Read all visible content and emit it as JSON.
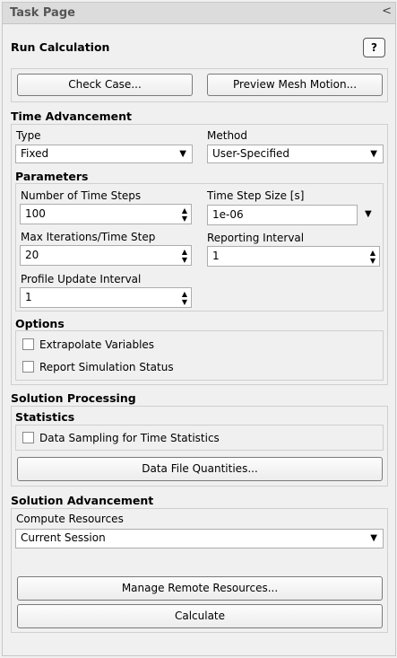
{
  "panel": {
    "title": "Task Page",
    "close": "<"
  },
  "run": {
    "heading": "Run Calculation",
    "help": "?"
  },
  "buttons": {
    "check_case": "Check Case...",
    "preview_mesh": "Preview Mesh Motion..."
  },
  "time_adv": {
    "heading": "Time Advancement",
    "type_label": "Type",
    "type_value": "Fixed",
    "method_label": "Method",
    "method_value": "User-Specified"
  },
  "params": {
    "heading": "Parameters",
    "num_steps_label": "Number of Time Steps",
    "num_steps_value": "100",
    "step_size_label": "Time Step Size [s]",
    "step_size_value": "1e-06",
    "max_iter_label": "Max Iterations/Time Step",
    "max_iter_value": "20",
    "report_label": "Reporting Interval",
    "report_value": "1",
    "profile_label": "Profile Update Interval",
    "profile_value": "1"
  },
  "options": {
    "heading": "Options",
    "extrapolate": "Extrapolate Variables",
    "report_status": "Report Simulation Status"
  },
  "solution_processing": {
    "heading": "Solution Processing",
    "statistics_heading": "Statistics",
    "data_sampling": "Data Sampling for Time Statistics",
    "data_file_btn": "Data File Quantities..."
  },
  "solution_adv": {
    "heading": "Solution Advancement",
    "compute_label": "Compute Resources",
    "compute_value": "Current Session",
    "manage_btn": "Manage Remote Resources...",
    "calculate_btn": "Calculate"
  }
}
